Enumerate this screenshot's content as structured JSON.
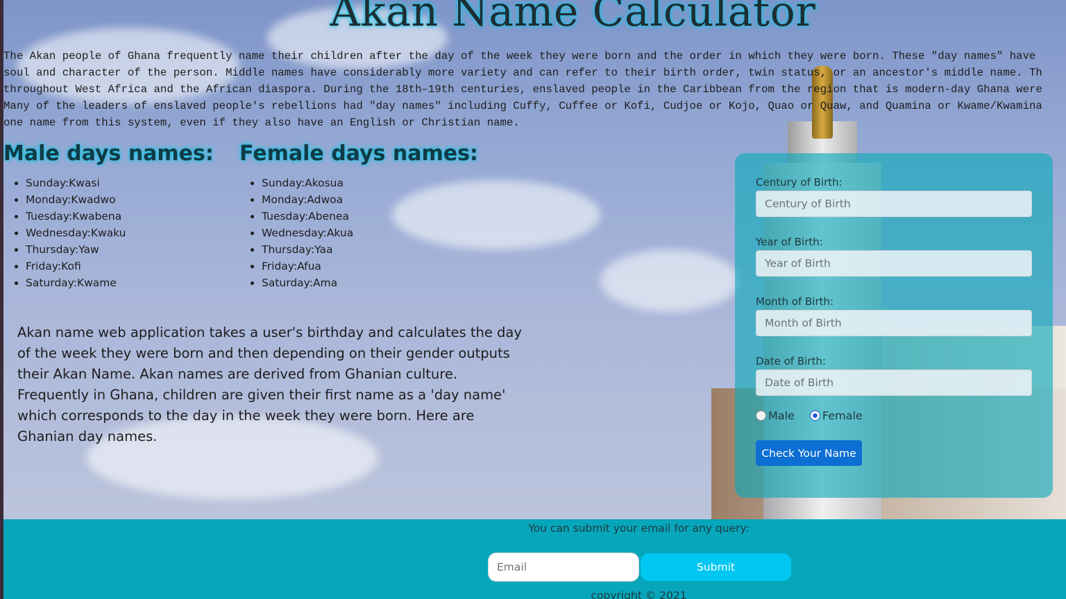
{
  "header": {
    "title": "Akan Name Calculator"
  },
  "intro": {
    "text": "The Akan people of Ghana frequently name their children after the day of the week they were born and the order in which they were born. These \"day names\" have\nsoul and character of the person. Middle names have considerably more variety and can refer to their birth order, twin status, or an ancestor's middle name. Th\nthroughout West Africa and the African diaspora. During the 18th–19th centuries, enslaved people in the Caribbean from the region that is modern-day Ghana were\nMany of the leaders of enslaved people's rebellions had \"day names\" including Cuffy, Cuffee or Kofi, Cudjoe or Kojo, Quao or Quaw, and Quamina or Kwame/Kwamina\none name from this system, even if they also have an English or Christian name."
  },
  "male": {
    "title": "Male days names:",
    "items": [
      "Sunday:Kwasi",
      "Monday:Kwadwo",
      "Tuesday:Kwabena",
      "Wednesday:Kwaku",
      "Thursday:Yaw",
      "Friday:Kofi",
      "Saturday:Kwame"
    ]
  },
  "female": {
    "title": "Female days names:",
    "items": [
      "Sunday:Akosua",
      "Monday:Adwoa",
      "Tuesday:Abenea",
      "Wednesday:Akua",
      "Thursday:Yaa",
      "Friday:Afua",
      "Saturday:Ama"
    ]
  },
  "description": {
    "text": "Akan name web application takes a user's birthday and calculates the day of the week they were born and then depending on their gender outputs their Akan Name. Akan names are derived from Ghanian culture. Frequently in Ghana, children are given their first name as a 'day name' which corresponds to the day in the week they were born. Here are Ghanian day names."
  },
  "form": {
    "century": {
      "label": "Century of Birth:",
      "placeholder": "Century of Birth",
      "value": ""
    },
    "year": {
      "label": "Year of Birth:",
      "placeholder": "Year of Birth",
      "value": ""
    },
    "month": {
      "label": "Month of Birth:",
      "placeholder": "Month of Birth",
      "value": ""
    },
    "date": {
      "label": "Date of Birth:",
      "placeholder": "Date of Birth",
      "value": ""
    },
    "gender": {
      "male_label": "Male",
      "female_label": "Female",
      "selected": "Female"
    },
    "submit_label": "Check Your Name"
  },
  "footer": {
    "prompt": "You can submit your email for any query:",
    "email_placeholder": "Email",
    "submit_label": "Submit",
    "copyright": "copyright © 2021"
  },
  "colors": {
    "accent_glow": "#10c7e8",
    "footer_bg": "#07a6bb",
    "primary_button": "#0d6ed3",
    "footer_button": "#00c7f2"
  }
}
